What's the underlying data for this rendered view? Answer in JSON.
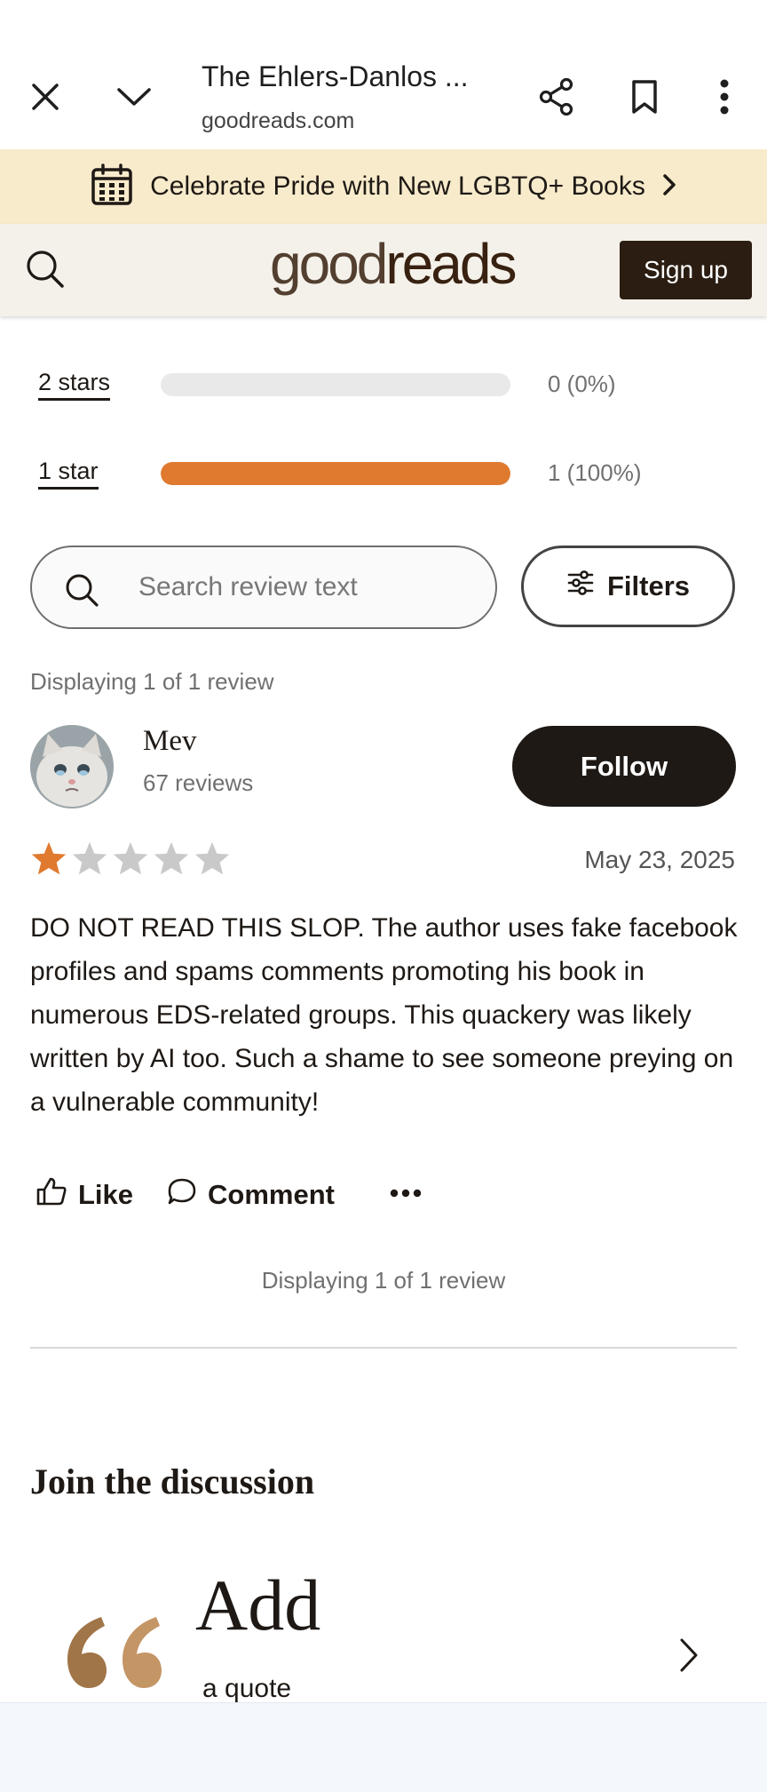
{
  "browser": {
    "tab_title": "The Ehlers-Danlos ...",
    "url": "goodreads.com",
    "icons": [
      "close-icon",
      "chevron-down-icon",
      "share-icon",
      "bookmark-icon",
      "more-vert-icon"
    ]
  },
  "promo": {
    "text": "Celebrate Pride with New LGBTQ+ Books",
    "icon": "calendar-icon"
  },
  "header": {
    "logo_light": "good",
    "logo_bold": "reads",
    "signup_label": "Sign up"
  },
  "ratings": [
    {
      "label": "2 stars",
      "count": "0 (0%)",
      "fraction": 0.0
    },
    {
      "label": "1 star",
      "count": "1 (100%)",
      "fraction": 1.0
    }
  ],
  "search": {
    "placeholder": "Search review text",
    "value": "",
    "filters_label": "Filters"
  },
  "display_count_top": "Displaying 1 of 1 review",
  "review": {
    "reviewer_name": "Mev",
    "reviewer_reviews": "67 reviews",
    "follow_label": "Follow",
    "rating": 1,
    "max_rating": 5,
    "date": "May 23, 2025",
    "text": "DO NOT READ THIS SLOP. The author uses fake facebook profiles and spams comments promoting his book in numerous EDS-related groups. This quackery was likely written by AI too. Such a shame to see someone preying on a vulnerable community!",
    "like_label": "Like",
    "comment_label": "Comment"
  },
  "display_count_bottom": "Displaying 1 of 1 review",
  "discussion": {
    "title": "Join the discussion",
    "add_word": "Add",
    "add_sub": "a quote"
  },
  "colors": {
    "accent_orange": "#e07a2f",
    "dark_brown": "#2b1d12",
    "banner_bg": "#f8ebcc",
    "header_bg": "#f4f1ea"
  }
}
